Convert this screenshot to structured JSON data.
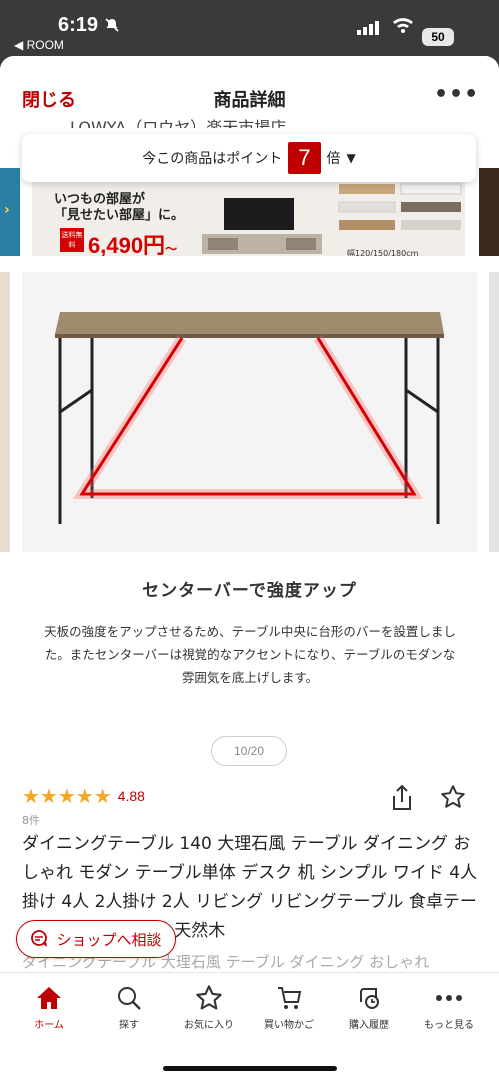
{
  "status": {
    "time": "6:19",
    "back_app": "◀ ROOM",
    "battery": "50"
  },
  "nav": {
    "close_label": "閉じる",
    "title": "商品詳細",
    "more_label": "•••"
  },
  "header_cut_text": "LOWYA（ロウヤ）楽天市場店",
  "points": {
    "prefix": "今この商品はポイント",
    "multiplier": "7",
    "suffix": "倍"
  },
  "banner": {
    "tagline_1": "いつもの部屋が",
    "tagline_2": "「見せたい部屋」に。",
    "badge": "送料無料",
    "price": "6,490円",
    "price_suffix": "〜",
    "sizes": "幅120/150/180cm"
  },
  "feature": {
    "heading": "センターバーで強度アップ",
    "description": "天板の強度をアップさせるため、テーブル中央に台形のバーを設置しました。またセンターバーは視覚的なアクセントになり、テーブルのモダンな雰囲気を底上げします。"
  },
  "gallery": {
    "counter": "10/20"
  },
  "product": {
    "stars": "★★★★★",
    "rating": "4.88",
    "review_count": "8件",
    "title": "ダイニングテーブル 140 大理石風 テーブル ダイニング おしゃれ モダン テーブル単体 デスク 机 シンプル ワイド 4人掛け 4人 2人掛け 2人 リビング リビングテーブル 食卓テーブル キッチン 横長 天然木",
    "subtitle_cut": "ダイニングテーブル 大理石風 テーブル ダイニング おしゃれ"
  },
  "shop_button": {
    "label": "ショップへ相談"
  },
  "tabs": [
    {
      "label": "ホーム",
      "icon": "home-icon"
    },
    {
      "label": "探す",
      "icon": "search-icon"
    },
    {
      "label": "お気に入り",
      "icon": "star-icon"
    },
    {
      "label": "買い物かご",
      "icon": "cart-icon"
    },
    {
      "label": "購入履歴",
      "icon": "history-icon"
    },
    {
      "label": "もっと見る",
      "icon": "more-icon"
    }
  ],
  "colors": {
    "accent": "#bf0000",
    "star": "#f5a623"
  }
}
